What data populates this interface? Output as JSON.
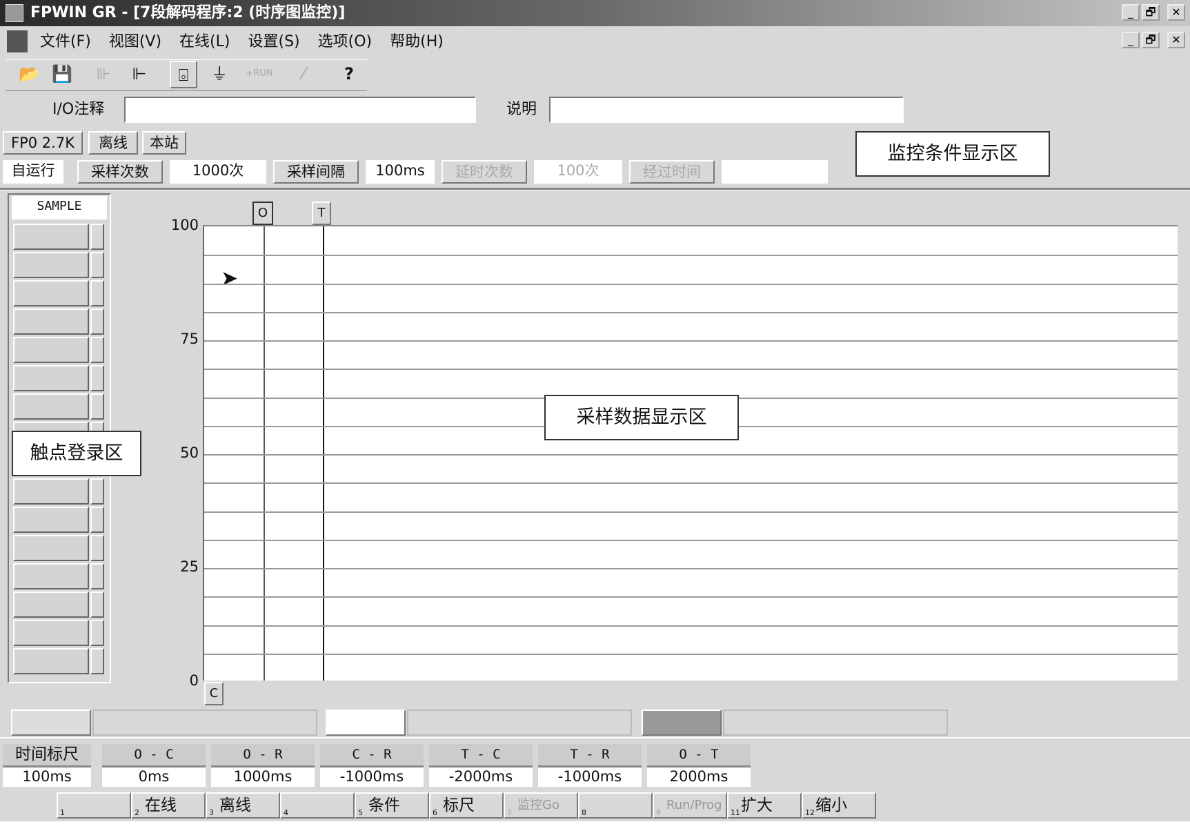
{
  "window": {
    "title": "FPWIN GR - [7段解码程序:2 (时序图监控)]",
    "min": "_",
    "restore": "🗗",
    "close": "✕"
  },
  "menu": [
    "文件(F)",
    "视图(V)",
    "在线(L)",
    "设置(S)",
    "选项(O)",
    "帮助(H)"
  ],
  "toolbar": {
    "run_label": "+RUN",
    "help": "?"
  },
  "io": {
    "comment_label": "I/O注释",
    "comment_value": "",
    "desc_label": "说明",
    "desc_value": ""
  },
  "status": {
    "plc": "FP0 2.7K",
    "mode": "离线",
    "station": "本站"
  },
  "monitor": {
    "run": "自运行",
    "samples_label": "采样次数",
    "samples": "1000次",
    "interval_label": "采样间隔",
    "interval": "100ms",
    "delay_label": "延时次数",
    "delay": "100次",
    "elapsed_label": "经过时间",
    "elapsed": ""
  },
  "callouts": {
    "condition": "监控条件显示区",
    "data": "采样数据显示区",
    "contacts": "触点登录区"
  },
  "panel": {
    "sample": "SAMPLE"
  },
  "chart": {
    "y_ticks": [
      "100",
      "75",
      "50",
      "25",
      "0"
    ],
    "marker_o": "O",
    "marker_t": "T",
    "marker_c": "C"
  },
  "timescale": {
    "label": "时间标尺",
    "value": "100ms",
    "cols": [
      {
        "h": "O - C",
        "v": "0ms"
      },
      {
        "h": "O - R",
        "v": "1000ms"
      },
      {
        "h": "C - R",
        "v": "-1000ms"
      },
      {
        "h": "T - C",
        "v": "-2000ms"
      },
      {
        "h": "T - R",
        "v": "-1000ms"
      },
      {
        "h": "O - T",
        "v": "2000ms"
      }
    ]
  },
  "fkeys": [
    {
      "n": "1",
      "l": ""
    },
    {
      "n": "2",
      "l": "在线"
    },
    {
      "n": "3",
      "l": "离线"
    },
    {
      "n": "4",
      "l": ""
    },
    {
      "n": "5",
      "l": "条件"
    },
    {
      "n": "6",
      "l": "标尺"
    },
    {
      "n": "7",
      "l": "监控Go"
    },
    {
      "n": "8",
      "l": ""
    },
    {
      "n": "9",
      "l": "Run/Prog"
    },
    {
      "n": "11",
      "l": "扩大"
    },
    {
      "n": "12",
      "l": "缩小"
    }
  ]
}
